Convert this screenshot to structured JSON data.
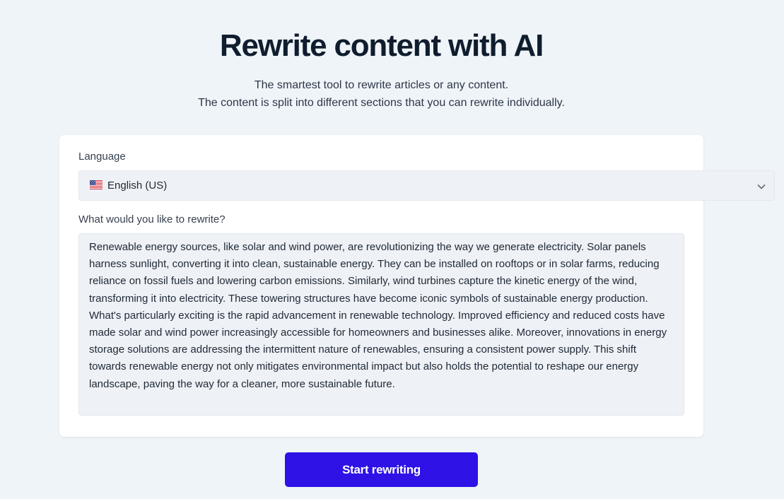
{
  "header": {
    "title": "Rewrite content with AI",
    "subtitle_line1": "The smartest tool to rewrite articles or any content.",
    "subtitle_line2": "The content is split into different sections that you can rewrite individually."
  },
  "form": {
    "language_label": "Language",
    "language_value": "English (US)",
    "language_flag_icon": "us-flag-icon",
    "rewrite_label": "What would you like to rewrite?",
    "rewrite_text": "Renewable energy sources, like solar and wind power, are revolutionizing the way we generate electricity. Solar panels harness sunlight, converting it into clean, sustainable energy. They can be installed on rooftops or in solar farms, reducing reliance on fossil fuels and lowering carbon emissions. Similarly, wind turbines capture the kinetic energy of the wind, transforming it into electricity. These towering structures have become iconic symbols of sustainable energy production. What's particularly exciting is the rapid advancement in renewable technology. Improved efficiency and reduced costs have made solar and wind power increasingly accessible for homeowners and businesses alike. Moreover, innovations in energy storage solutions are addressing the intermittent nature of renewables, ensuring a consistent power supply. This shift towards renewable energy not only mitigates environmental impact but also holds the potential to reshape our energy landscape, paving the way for a cleaner, more sustainable future.",
    "submit_label": "Start rewriting"
  },
  "colors": {
    "background": "#eff4f8",
    "card": "#ffffff",
    "field": "#eef1f5",
    "button": "#2e12e6",
    "title": "#0f1d2e"
  }
}
